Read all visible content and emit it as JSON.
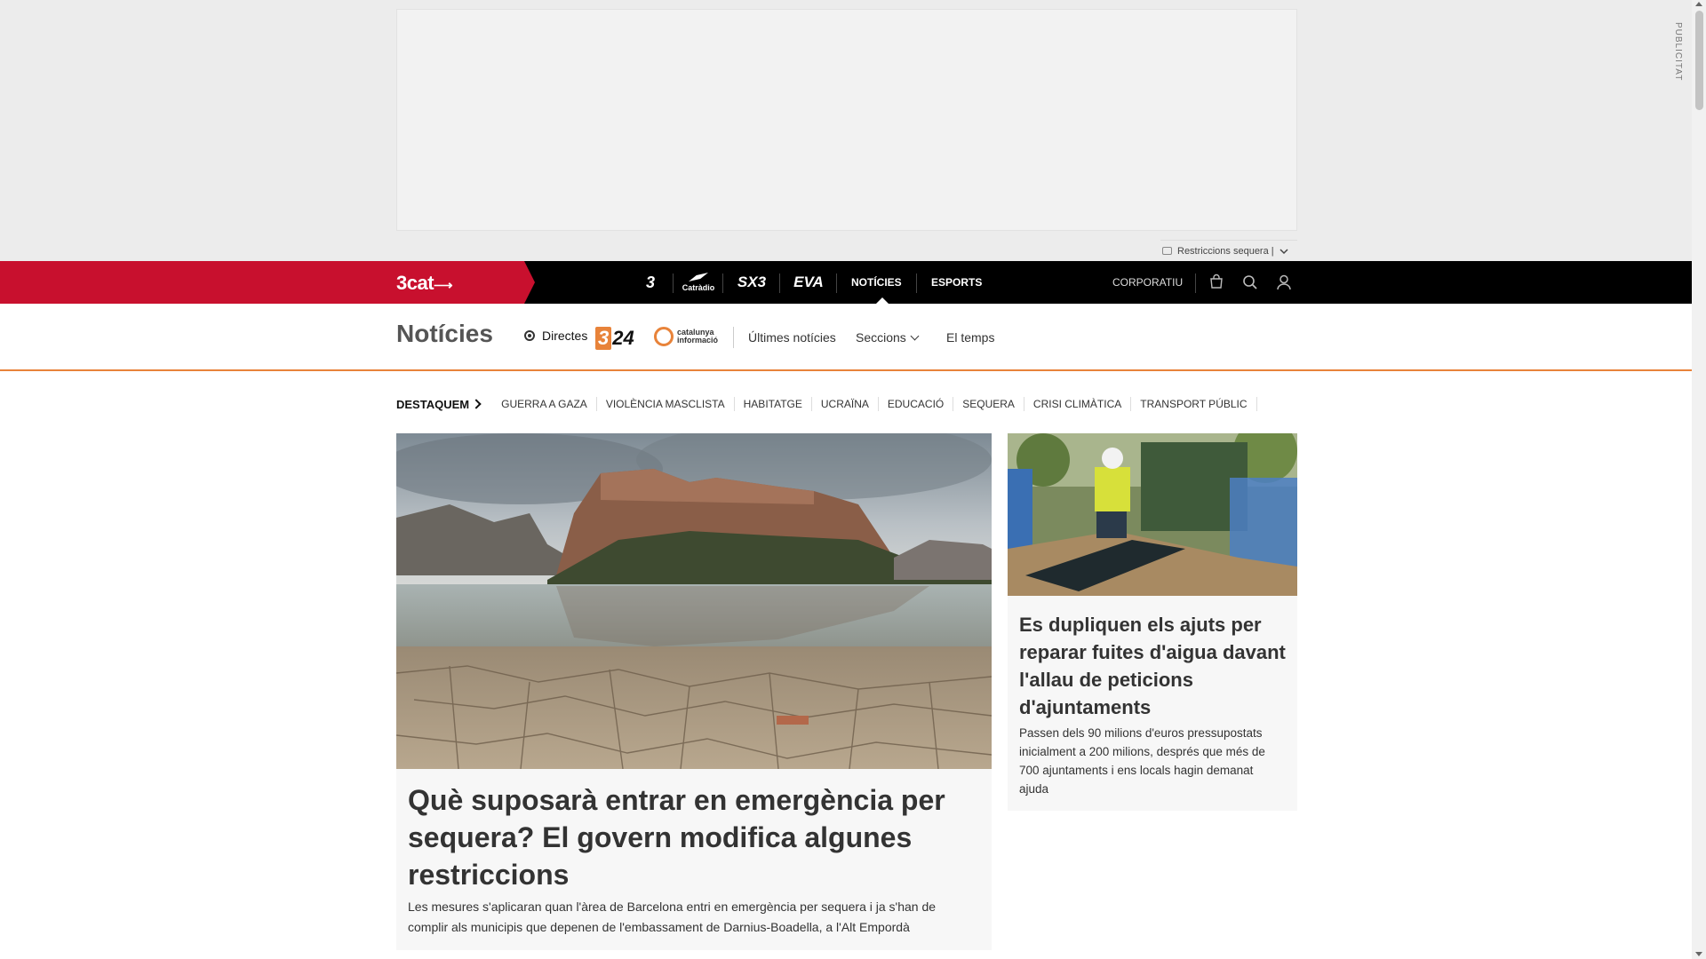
{
  "ad": {
    "label": "PUBLICITAT"
  },
  "ticker": {
    "text": "Restriccions sequera |"
  },
  "topnav": {
    "brand": "3cat",
    "channels": [
      {
        "name": "TV3",
        "label": "3"
      },
      {
        "name": "Catalunya Ràdio",
        "label": "Catràdio"
      },
      {
        "name": "SX3",
        "label": "SX3"
      },
      {
        "name": "EVA",
        "label": "EVA"
      }
    ],
    "links": {
      "noticies": "NOTÍCIES",
      "esports": "ESPORTS",
      "corporatiu": "CORPORATIU"
    },
    "icons": [
      "cart-icon",
      "search-icon",
      "user-icon"
    ]
  },
  "section": {
    "title": "Notícies",
    "directes": "Directes",
    "logo_324": "24",
    "logo_324_three": "3",
    "catinfo": "catalunya informació",
    "ultimes": "Últimes notícies",
    "seccions": "Seccions",
    "temps": "El temps"
  },
  "destaquem": {
    "label": "DESTAQUEM",
    "topics": [
      "GUERRA A GAZA",
      "VIOLÈNCIA MASCLISTA",
      "HABITATGE",
      "UCRAÏNA",
      "EDUCACIÓ",
      "SEQUERA",
      "CRISI CLIMÀTICA",
      "TRANSPORT PÚBLIC"
    ]
  },
  "main_article": {
    "headline": "Què suposarà entrar en emergència per sequera? El govern modifica algunes restriccions",
    "summary": "Les mesures s'aplicaran quan l'àrea de Barcelona entri en emergència per sequera i ja s'han de complir als municipis que depenen de l'embassament de Darnius-Boadella, a l'Alt Empordà"
  },
  "side_article": {
    "headline": "Es dupliquen els ajuts per reparar fuites d'aigua davant l'allau de peticions d'ajuntaments",
    "summary": "Passen dels 90 milions d'euros pressupostats inicialment a 200 milions, després que més de 700 ajuntaments i ens locals hagin demanat ajuda"
  },
  "colors": {
    "brand_red": "#c8102e",
    "accent_orange": "#e8833a",
    "nav_black": "#000000"
  }
}
